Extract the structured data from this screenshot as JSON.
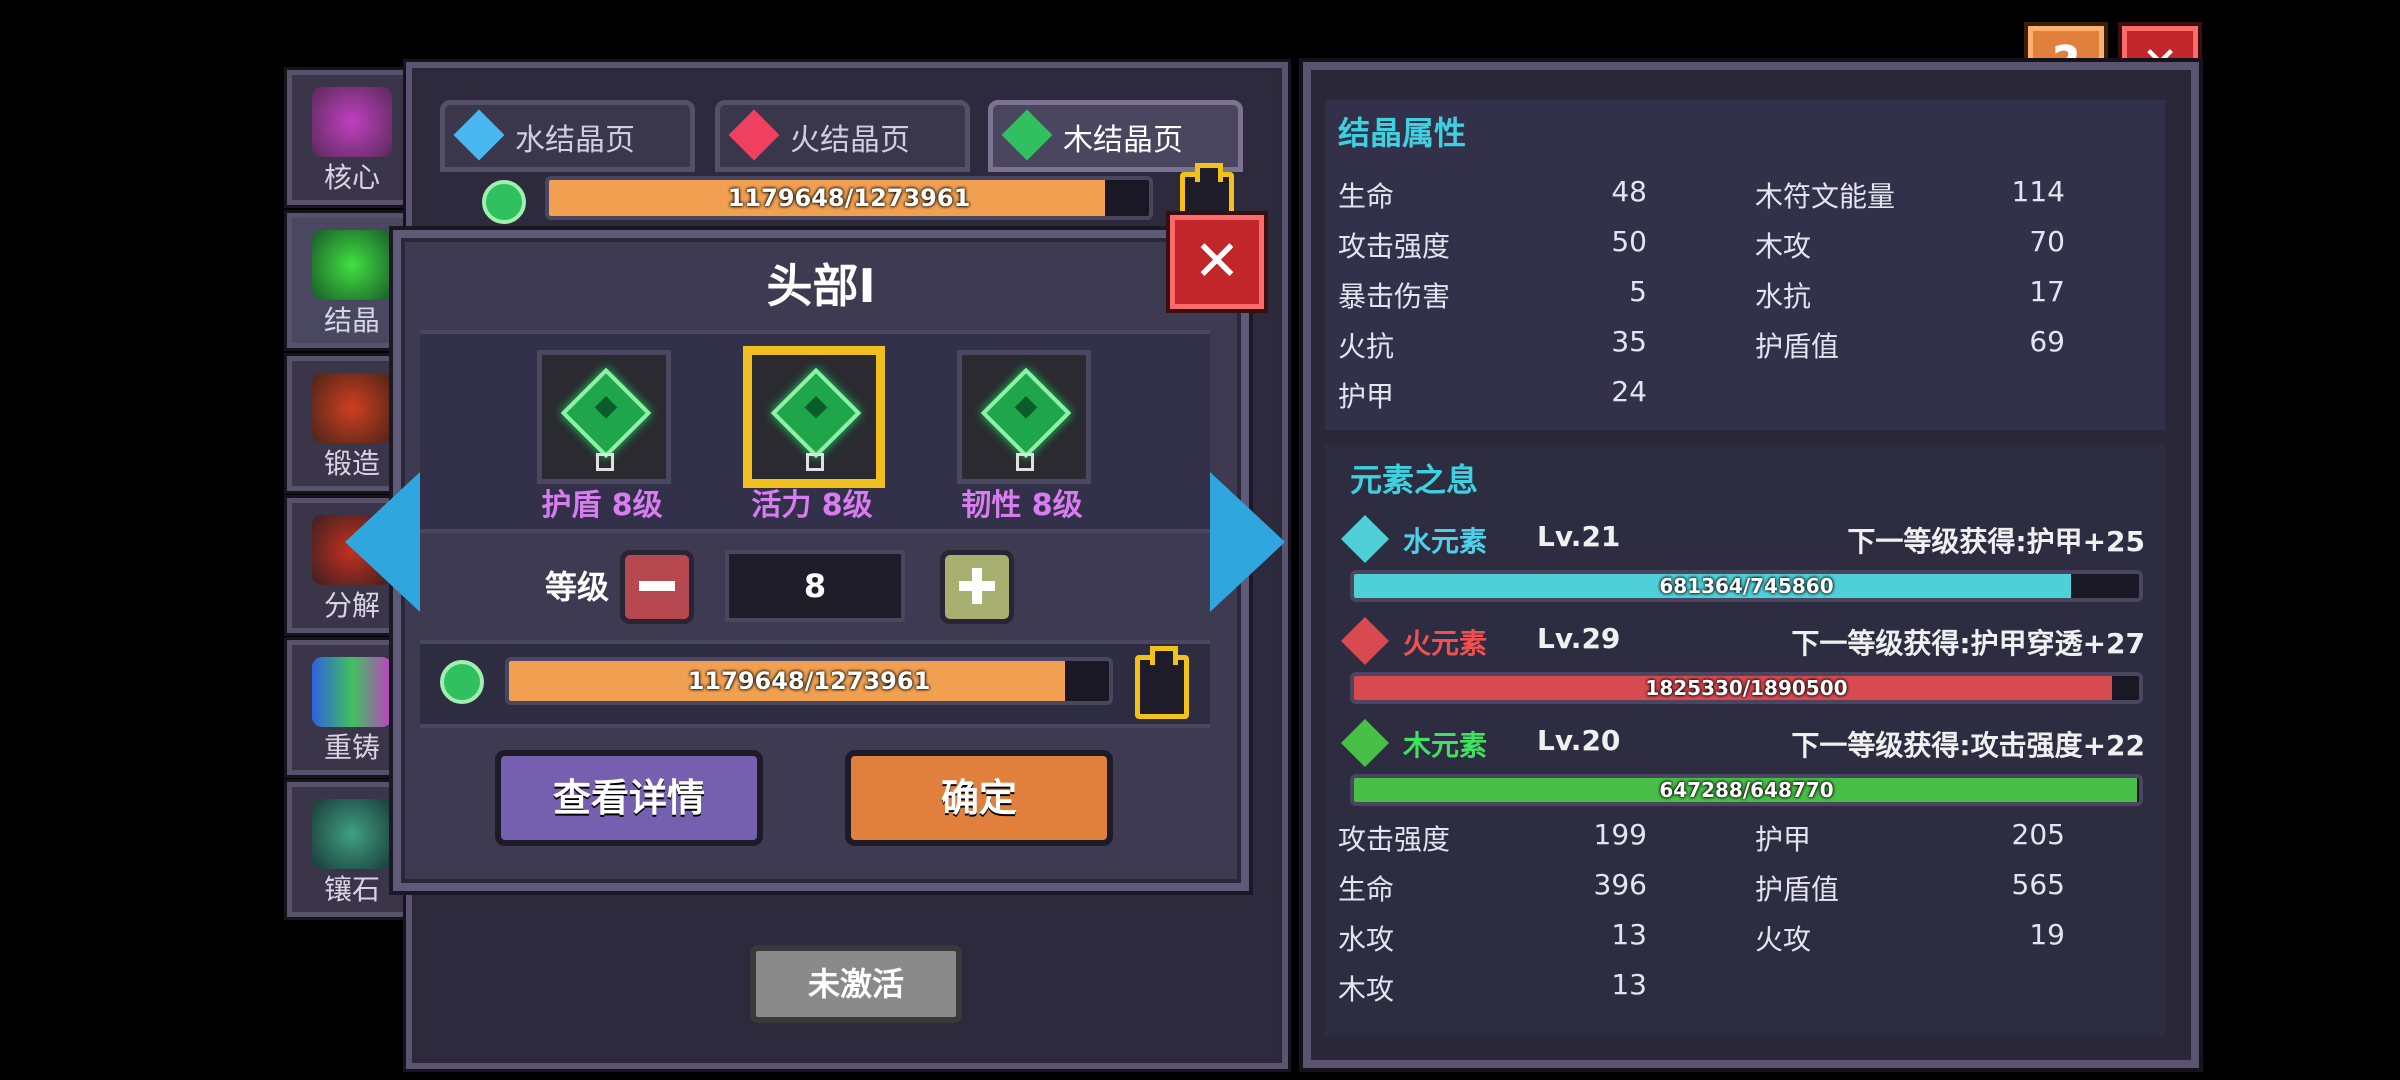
{
  "side_menu": [
    {
      "label": "核心"
    },
    {
      "label": "结晶"
    },
    {
      "label": "锻造"
    },
    {
      "label": "分解"
    },
    {
      "label": "重铸"
    },
    {
      "label": "镶石"
    }
  ],
  "tabs": [
    {
      "label": "水结晶页",
      "color": "#4ab8f0"
    },
    {
      "label": "火结晶页",
      "color": "#f04060"
    },
    {
      "label": "木结晶页",
      "color": "#30c060"
    }
  ],
  "top_bar": {
    "text": "1179648/1273961",
    "fraction": 0.926
  },
  "inactive_button": "未激活",
  "dialog": {
    "title": "头部I",
    "slots": [
      {
        "label": "护盾 8级",
        "selected": false
      },
      {
        "label": "活力 8级",
        "selected": true
      },
      {
        "label": "韧性 8级",
        "selected": false
      }
    ],
    "slot_lock_text": "8",
    "level_label": "等级",
    "level_value": "8",
    "bar": {
      "text": "1179648/1273961",
      "fraction": 0.926
    },
    "details_button": "查看详情",
    "confirm_button": "确定"
  },
  "right_panel": {
    "crystal_title": "结晶属性",
    "crystal_stats_left": [
      {
        "name": "生命",
        "value": "48"
      },
      {
        "name": "攻击强度",
        "value": "50"
      },
      {
        "name": "暴击伤害",
        "value": "5"
      },
      {
        "name": "火抗",
        "value": "35"
      },
      {
        "name": "护甲",
        "value": "24"
      }
    ],
    "crystal_stats_right": [
      {
        "name": "木符文能量",
        "value": "114"
      },
      {
        "name": "木攻",
        "value": "70"
      },
      {
        "name": "水抗",
        "value": "17"
      },
      {
        "name": "护盾值",
        "value": "69"
      }
    ],
    "element_title": "元素之息",
    "elements": [
      {
        "name": "水元素",
        "level": "Lv.21",
        "next": "下一等级获得:护甲+25",
        "progress": "681364/745860",
        "fraction": 0.913,
        "color": "#4fd0d8",
        "name_color": "#4fd0e8"
      },
      {
        "name": "火元素",
        "level": "Lv.29",
        "next": "下一等级获得:护甲穿透+27",
        "progress": "1825330/1890500",
        "fraction": 0.966,
        "color": "#d84a50",
        "name_color": "#f05050"
      },
      {
        "name": "木元素",
        "level": "Lv.20",
        "next": "下一等级获得:攻击强度+22",
        "progress": "647288/648770",
        "fraction": 0.998,
        "color": "#48c048",
        "name_color": "#40e060"
      }
    ],
    "element_stats_left": [
      {
        "name": "攻击强度",
        "value": "199"
      },
      {
        "name": "生命",
        "value": "396"
      },
      {
        "name": "水攻",
        "value": "13"
      },
      {
        "name": "木攻",
        "value": "13"
      }
    ],
    "element_stats_right": [
      {
        "name": "护甲",
        "value": "205"
      },
      {
        "name": "护盾值",
        "value": "565"
      },
      {
        "name": "火攻",
        "value": "19"
      }
    ]
  },
  "help_icon": "?",
  "close_icon": "✕"
}
